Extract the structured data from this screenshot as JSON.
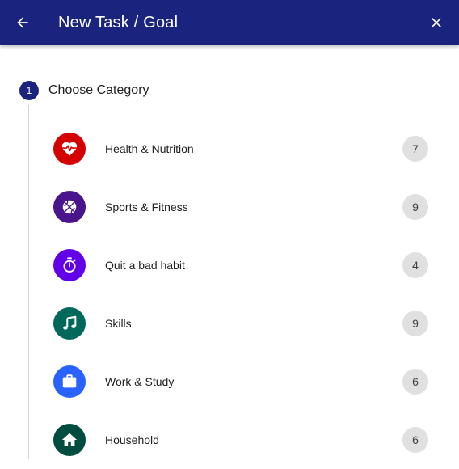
{
  "appbar": {
    "title": "New Task / Goal",
    "back_icon": "arrow-back-icon",
    "close_icon": "close-icon",
    "color": "#1a237e"
  },
  "step": {
    "number": "1",
    "label": "Choose Category"
  },
  "categories": [
    {
      "label": "Health & Nutrition",
      "count": "7",
      "icon": "heart-pulse-icon",
      "color": "#d50000"
    },
    {
      "label": "Sports & Fitness",
      "count": "9",
      "icon": "basketball-icon",
      "color": "#4a148c"
    },
    {
      "label": "Quit a bad habit",
      "count": "4",
      "icon": "stopwatch-icon",
      "color": "#6200ea"
    },
    {
      "label": "Skills",
      "count": "9",
      "icon": "music-note-icon",
      "color": "#00695c"
    },
    {
      "label": "Work & Study",
      "count": "6",
      "icon": "briefcase-icon",
      "color": "#2962ff"
    },
    {
      "label": "Household",
      "count": "6",
      "icon": "home-icon",
      "color": "#004d40"
    }
  ]
}
